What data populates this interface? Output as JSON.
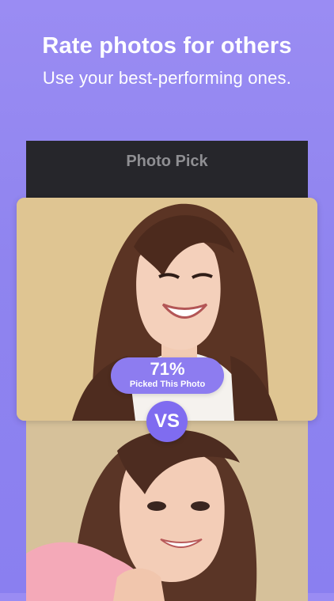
{
  "header": {
    "title": "Rate photos for others",
    "subtitle": "Use your best-performing ones."
  },
  "app_bar": {
    "title": "Photo Pick"
  },
  "result": {
    "percent": "71%",
    "label": "Picked This Photo"
  },
  "comparison": {
    "vs_label": "VS"
  },
  "colors": {
    "background": "#9a8cf3",
    "accent": "#8d7cf0",
    "app_bar": "#26262b",
    "photo_bg_top": "#dfc592",
    "photo_bg_bottom": "#d6c19a"
  }
}
